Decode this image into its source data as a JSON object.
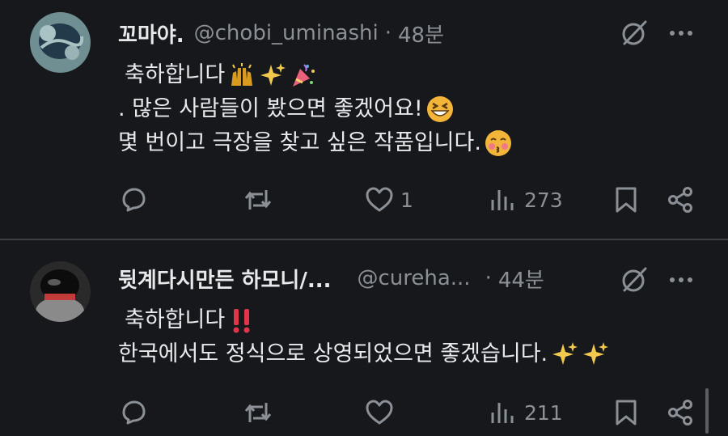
{
  "posts": [
    {
      "display_name": "꼬마야.",
      "handle": "@chobi_uminashi",
      "separator": "·",
      "time": "48분",
      "text_lines": [
        "축하합니다",
        ". 많은 사람들이 봤으면 좋겠어요!",
        "몇 번이고 극장을 찾고 싶은 작품입니다."
      ],
      "line_emojis": [
        [
          "raising-hands",
          "sparkles",
          "party-popper"
        ],
        [
          "grinning-squint"
        ],
        [
          "kissing-blush"
        ]
      ],
      "likes": "1",
      "views": "273"
    },
    {
      "display_name": "뒷계다시만든 하모니/...",
      "handle": "@cureha...",
      "separator": "·",
      "time": "44분",
      "text_lines": [
        "축하합니다",
        "한국에서도 정식으로 상영되었으면 좋겠습니다."
      ],
      "line_emojis": [
        [
          "double-exclamation"
        ],
        [
          "sparkles",
          "sparkles"
        ]
      ],
      "likes": "",
      "views": "211"
    }
  ],
  "colors": {
    "background": "#16181c",
    "text": "#e7e9ea",
    "muted": "#8b9096",
    "divider": "#3b3f44"
  }
}
